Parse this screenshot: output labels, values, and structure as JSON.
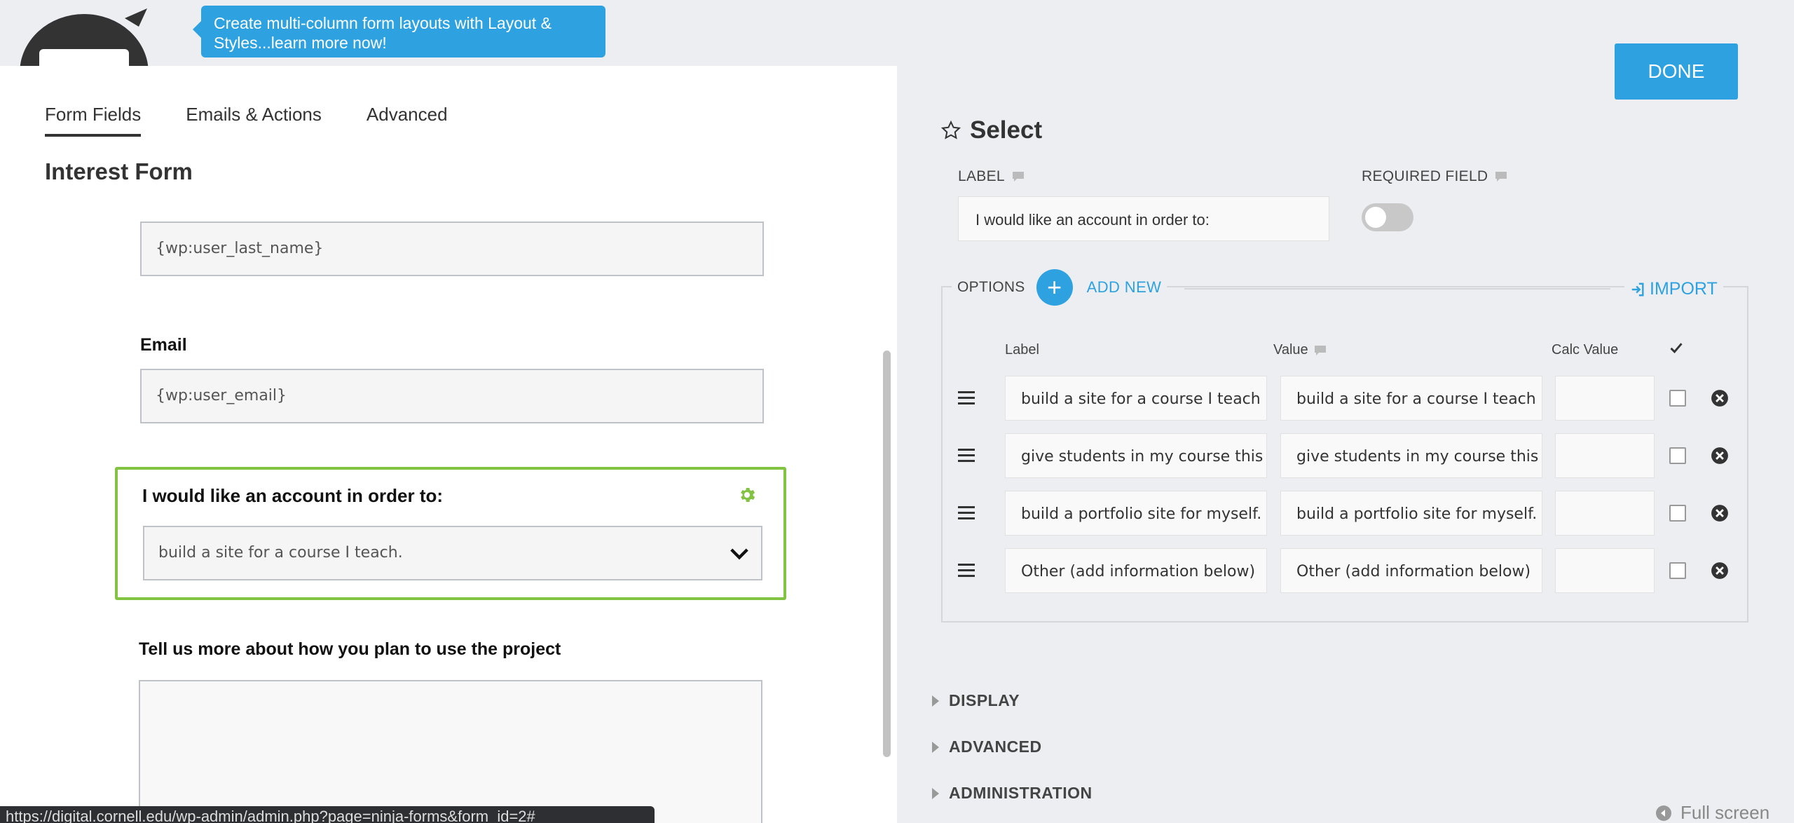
{
  "header": {
    "promo_text": "Create multi-column form layouts with Layout & Styles...learn more now!"
  },
  "tabs": [
    {
      "label": "Form Fields",
      "active": true
    },
    {
      "label": "Emails & Actions",
      "active": false
    },
    {
      "label": "Advanced",
      "active": false
    }
  ],
  "form": {
    "title": "Interest Form",
    "last_name_value": "{wp:user_last_name}",
    "email_label": "Email",
    "email_value": "{wp:user_email}",
    "select_label": "I would like an account in order to:",
    "select_value": "build a site for a course I teach.",
    "textarea_label": "Tell us more about how you plan to use the project"
  },
  "status_url": "https://digital.cornell.edu/wp-admin/admin.php?page=ninja-forms&form_id=2#",
  "panel": {
    "done_label": "DONE",
    "title": "Select",
    "label_heading": "LABEL",
    "label_value": "I would like an account in order to:",
    "required_heading": "REQUIRED FIELD",
    "required_on": false,
    "options_heading": "OPTIONS",
    "add_new_label": "ADD NEW",
    "import_label": "IMPORT",
    "columns": {
      "label": "Label",
      "value": "Value",
      "calc": "Calc Value"
    },
    "options": [
      {
        "label": "build a site for a course I teach",
        "value": "build a site for a course I teach",
        "calc": "",
        "checked": false
      },
      {
        "label": "give students in my course this",
        "value": "give students in my course this",
        "calc": "",
        "checked": false
      },
      {
        "label": "build a portfolio site for myself.",
        "value": "build a portfolio site for myself.",
        "calc": "",
        "checked": false
      },
      {
        "label": "Other (add information below)",
        "value": "Other (add information below)",
        "calc": "",
        "checked": false
      }
    ],
    "sections": [
      "DISPLAY",
      "ADVANCED",
      "ADMINISTRATION"
    ],
    "fullscreen_label": "Full screen"
  },
  "colors": {
    "accent": "#2ea2e0",
    "selected_border": "#82c341",
    "gear": "#82c341"
  }
}
